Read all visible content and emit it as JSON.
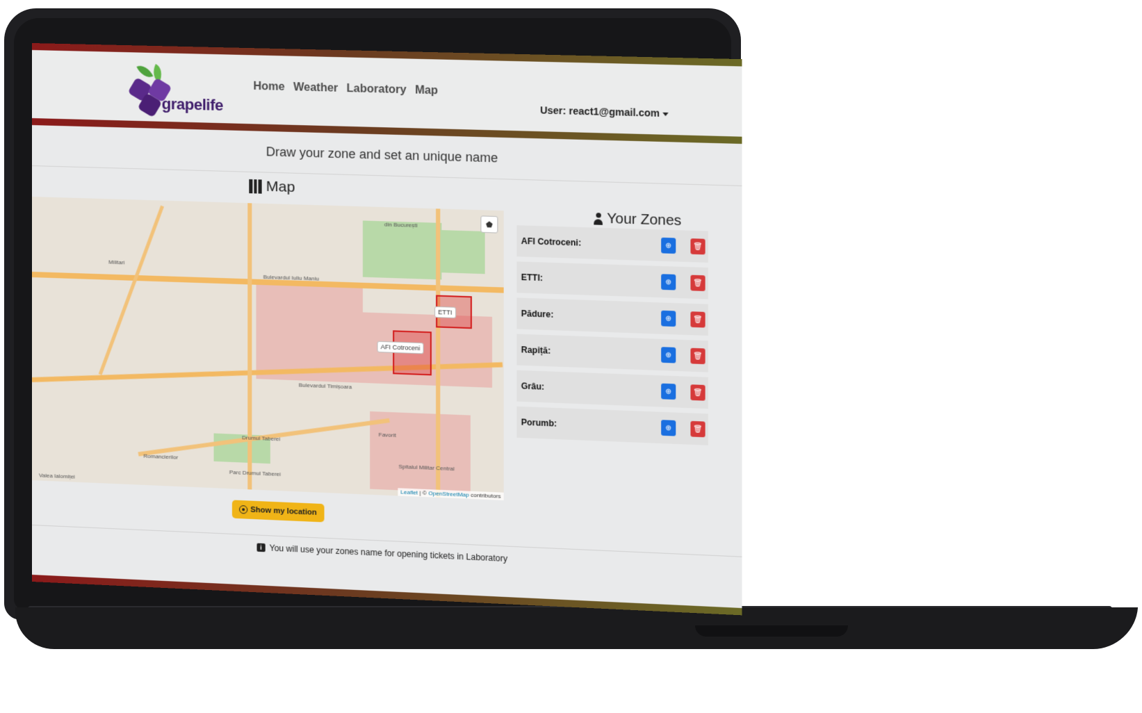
{
  "brand": {
    "name": "grapelife"
  },
  "nav": {
    "items": [
      {
        "label": "Home"
      },
      {
        "label": "Weather"
      },
      {
        "label": "Laboratory"
      },
      {
        "label": "Map"
      }
    ]
  },
  "user": {
    "label": "User: react1@gmail.com"
  },
  "page": {
    "subtitle": "Draw your zone and set an unique name"
  },
  "map": {
    "title": "Map",
    "zone_labels": [
      "AFI Cotroceni",
      "ETTI"
    ],
    "attribution": {
      "leaflet": "Leaflet",
      "separator": " | © ",
      "osm": "OpenStreetMap",
      "suffix": " contributors"
    },
    "street_labels": [
      "Bulevardul Iuliu Maniu",
      "Bulevardul Timișoara",
      "Drumul Taberei",
      "Militari",
      "din București",
      "Favorit",
      "Romancierilor",
      "Parc Drumul Taberei",
      "Spitalul Militar Central",
      "Valea Ialomiței"
    ]
  },
  "locate": {
    "label": "Show my location"
  },
  "zones": {
    "title": "Your Zones",
    "items": [
      {
        "name": "AFI Cotroceni:"
      },
      {
        "name": "ETTI:"
      },
      {
        "name": "Pădure:"
      },
      {
        "name": "Rapiță:"
      },
      {
        "name": "Grâu:"
      },
      {
        "name": "Porumb:"
      }
    ]
  },
  "footer": {
    "info_icon": "i",
    "text": "You will use your zones name for opening tickets in Laboratory"
  },
  "colors": {
    "primary": "#1a6fe0",
    "danger": "#d63a3a",
    "warning": "#f0b417",
    "brand": "#3f1d6b"
  }
}
